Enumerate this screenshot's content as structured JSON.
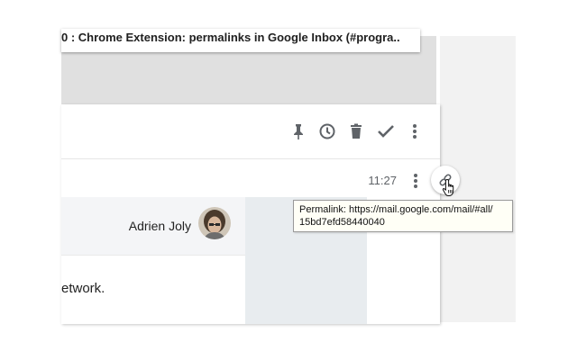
{
  "background_card": {
    "title": "0 : Chrome Extension: permalinks in Google Inbox (#progra.."
  },
  "toolbar": {
    "icons": [
      "pin-icon",
      "snooze-clock-icon",
      "trash-icon",
      "done-check-icon",
      "more-vert-icon"
    ]
  },
  "message": {
    "time": "11:27",
    "sender": "Adrien Joly",
    "body_snippet": "etwork."
  },
  "permalink_button": {
    "icon": "link-icon"
  },
  "tooltip": {
    "line1": "Permalink: https://mail.google.com/mail/#all/",
    "line2": "15bd7efd58440040"
  },
  "colors": {
    "icon": "#5f6368",
    "card_bg": "#ffffff",
    "sender_row_bg": "#f4f5f7",
    "side_pane_bg": "#e8ecef",
    "tooltip_bg": "#fffff6"
  }
}
